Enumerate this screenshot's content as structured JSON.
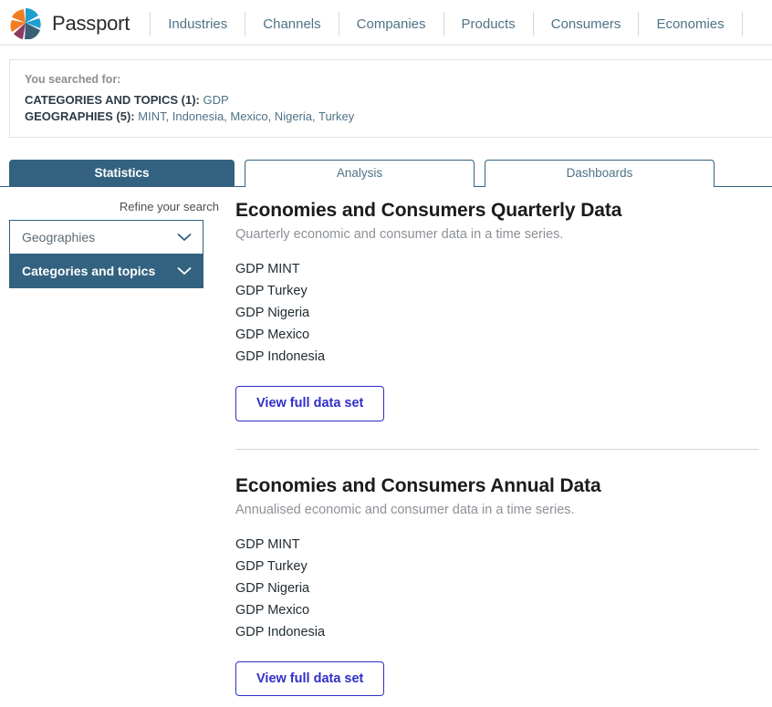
{
  "header": {
    "brand_name": "Passport",
    "logo_icon": "passport-pinwheel-logo",
    "nav_items": [
      {
        "label": "Industries"
      },
      {
        "label": "Channels"
      },
      {
        "label": "Companies"
      },
      {
        "label": "Products"
      },
      {
        "label": "Consumers"
      },
      {
        "label": "Economies"
      }
    ]
  },
  "search_summary": {
    "label": "You searched for:",
    "criteria": [
      {
        "key": "CATEGORIES AND TOPICS (1):",
        "values": "GDP"
      },
      {
        "key": "GEOGRAPHIES (5):",
        "values": "MINT, Indonesia, Mexico, Nigeria, Turkey"
      }
    ]
  },
  "tabs": [
    {
      "label": "Statistics",
      "active": true
    },
    {
      "label": "Analysis",
      "active": false
    },
    {
      "label": "Dashboards",
      "active": false
    }
  ],
  "sidebar": {
    "refine_label": "Refine your search",
    "facets": [
      {
        "label": "Geographies",
        "state": "open",
        "icon": "chevron-down-icon"
      },
      {
        "label": "Categories and topics",
        "state": "selected",
        "icon": "chevron-down-icon"
      }
    ]
  },
  "results": [
    {
      "title": "Economies and Consumers Quarterly Data",
      "subtitle": "Quarterly economic and consumer data in a time series.",
      "items": [
        "GDP MINT",
        "GDP Turkey",
        "GDP Nigeria",
        "GDP Mexico",
        "GDP Indonesia"
      ],
      "button_label": "View full data set"
    },
    {
      "title": "Economies and Consumers Annual Data",
      "subtitle": "Annualised economic and consumer data in a time series.",
      "items": [
        "GDP MINT",
        "GDP Turkey",
        "GDP Nigeria",
        "GDP Mexico",
        "GDP Indonesia"
      ],
      "button_label": "View full data set"
    }
  ],
  "colors": {
    "brand_teal": "#336280",
    "link_blue": "#4f7287",
    "button_blue": "#2f2fc8",
    "logo_orange": "#f07d22",
    "logo_cyan": "#1f9fd0",
    "logo_purple": "#8e3a62",
    "logo_navy": "#3a5f77"
  }
}
